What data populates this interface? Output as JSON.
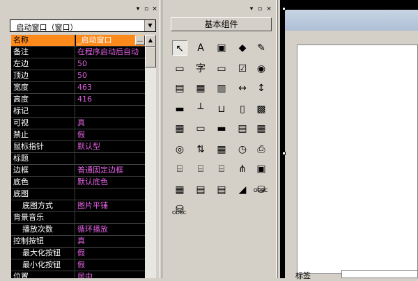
{
  "properties_panel": {
    "object_select": "_启动窗口（窗口）",
    "rows": [
      {
        "name": "名称",
        "value": "_启动窗口"
      },
      {
        "name": "备注",
        "value": "在程序启动后自动"
      },
      {
        "name": "左边",
        "value": "50"
      },
      {
        "name": "顶边",
        "value": "50"
      },
      {
        "name": "宽度",
        "value": "463"
      },
      {
        "name": "高度",
        "value": "416"
      },
      {
        "name": "标记",
        "value": ""
      },
      {
        "name": "可视",
        "value": "真"
      },
      {
        "name": "禁止",
        "value": "假"
      },
      {
        "name": "鼠标指针",
        "value": "默认型"
      },
      {
        "name": "标题",
        "value": ""
      },
      {
        "name": "边框",
        "value": "普通固定边框"
      },
      {
        "name": "底色",
        "value": "默认底色"
      },
      {
        "name": "底图",
        "value": ""
      },
      {
        "name": "底图方式",
        "value": "图片平铺"
      },
      {
        "name": "背景音乐",
        "value": ""
      },
      {
        "name": "播放次数",
        "value": "循环播放"
      },
      {
        "name": "控制按钮",
        "value": "真"
      },
      {
        "name": "最大化按钮",
        "value": "假"
      },
      {
        "name": "最小化按钮",
        "value": "假"
      },
      {
        "name": "位置",
        "value": "居中"
      }
    ],
    "ellipsis": "..."
  },
  "toolbox": {
    "title": "基本组件",
    "tools": [
      {
        "name": "pointer-tool",
        "glyph": "↖"
      },
      {
        "name": "label-tool",
        "glyph": "A"
      },
      {
        "name": "picture-box-tool",
        "glyph": "▣"
      },
      {
        "name": "shape-tool",
        "glyph": "◆"
      },
      {
        "name": "drawing-board-tool",
        "glyph": "✎"
      },
      {
        "name": "groupbox-tool",
        "glyph": "▭"
      },
      {
        "name": "text-tool",
        "glyph": "字"
      },
      {
        "name": "button-tool",
        "glyph": "▭"
      },
      {
        "name": "checkbox-tool",
        "glyph": "☑"
      },
      {
        "name": "radio-tool",
        "glyph": "◉"
      },
      {
        "name": "combobox-tool",
        "glyph": "▤"
      },
      {
        "name": "listbox-tool",
        "glyph": "▦"
      },
      {
        "name": "checklist-tool",
        "glyph": "▥"
      },
      {
        "name": "hscroll-tool",
        "glyph": "↔"
      },
      {
        "name": "vscroll-tool",
        "glyph": "↕"
      },
      {
        "name": "progress-tool",
        "glyph": "▬"
      },
      {
        "name": "slider-tool",
        "glyph": "┴"
      },
      {
        "name": "tab-tool",
        "glyph": "⊔"
      },
      {
        "name": "clock-tool",
        "glyph": "▯"
      },
      {
        "name": "richtext-tool",
        "glyph": "▩"
      },
      {
        "name": "grid-tool",
        "glyph": "▦"
      },
      {
        "name": "statusbar-tool",
        "glyph": "▭"
      },
      {
        "name": "folder-tool",
        "glyph": "▬"
      },
      {
        "name": "document-tool",
        "glyph": "▤"
      },
      {
        "name": "calendar-tool",
        "glyph": "▦"
      },
      {
        "name": "globe-tool",
        "glyph": "◎"
      },
      {
        "name": "spinner-tool",
        "glyph": "⇅"
      },
      {
        "name": "datetime-tool",
        "glyph": "▦"
      },
      {
        "name": "timer-tool",
        "glyph": "◷"
      },
      {
        "name": "printer-tool",
        "glyph": "⎙"
      },
      {
        "name": "server-tool",
        "glyph": "⌸"
      },
      {
        "name": "client-tool",
        "glyph": "⌸"
      },
      {
        "name": "port-tool",
        "glyph": "⌸"
      },
      {
        "name": "network-tool",
        "glyph": "⋔"
      },
      {
        "name": "table-tool",
        "glyph": "▣"
      },
      {
        "name": "frame-tool",
        "glyph": "▦"
      },
      {
        "name": "outline-tool",
        "glyph": "▤"
      },
      {
        "name": "database-tool",
        "glyph": "▤"
      },
      {
        "name": "chart-tool",
        "glyph": "◢"
      },
      {
        "name": "odbc-tool",
        "glyph": "⛁"
      },
      {
        "name": "odbc-source-tool",
        "glyph": "⛁"
      }
    ],
    "odbc_label": "ODBC"
  },
  "designer": {
    "label_text": "标签"
  }
}
